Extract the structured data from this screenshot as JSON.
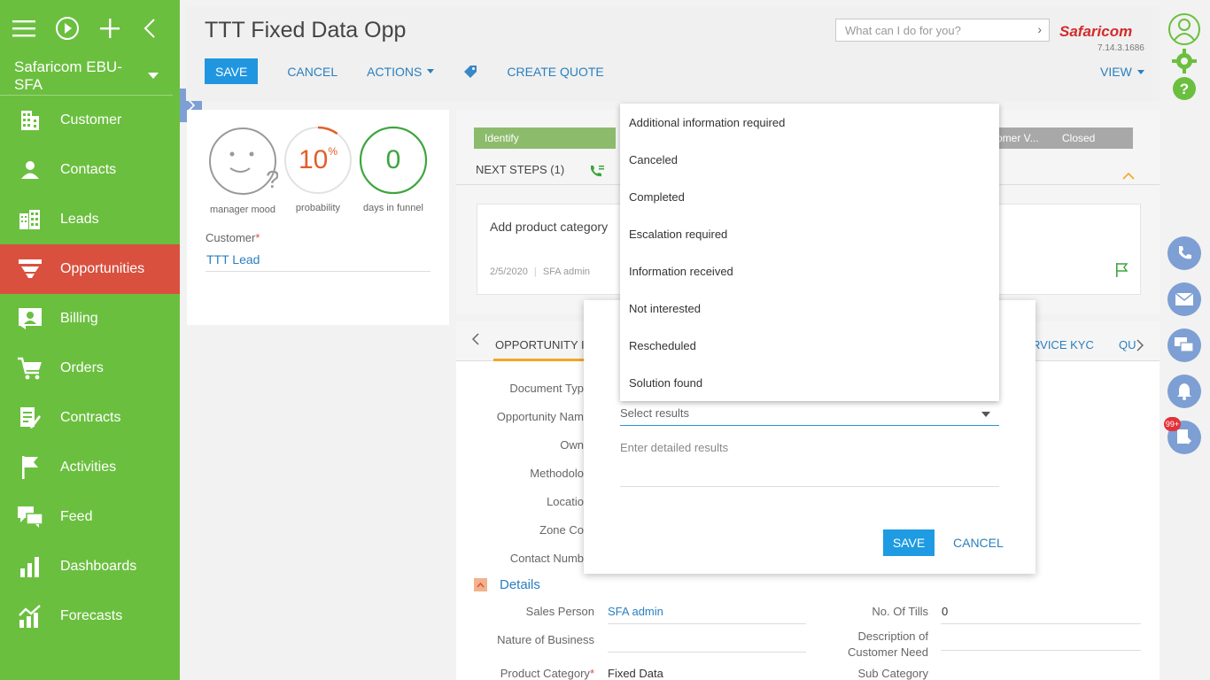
{
  "sidebar": {
    "workspace": "Safaricom EBU-SFA",
    "items": [
      {
        "label": "Customer",
        "icon": "building-icon"
      },
      {
        "label": "Contacts",
        "icon": "person-icon"
      },
      {
        "label": "Leads",
        "icon": "buildings-icon"
      },
      {
        "label": "Opportunities",
        "icon": "funnel-icon"
      },
      {
        "label": "Billing",
        "icon": "id-card-icon"
      },
      {
        "label": "Orders",
        "icon": "cart-icon"
      },
      {
        "label": "Contracts",
        "icon": "document-pen-icon"
      },
      {
        "label": "Activities",
        "icon": "flag-icon"
      },
      {
        "label": "Feed",
        "icon": "chat-icon"
      },
      {
        "label": "Dashboards",
        "icon": "bar-chart-icon"
      },
      {
        "label": "Forecasts",
        "icon": "trend-chart-icon"
      }
    ],
    "active_item": "Opportunities"
  },
  "header": {
    "title": "TTT Fixed Data Opp",
    "save_label": "SAVE",
    "cancel_label": "CANCEL",
    "actions_label": "ACTIONS",
    "create_quote_label": "CREATE QUOTE",
    "view_label": "VIEW",
    "search_placeholder": "What can I do for you?",
    "logo_text": "Safaricom",
    "version": "7.14.3.1686"
  },
  "summary": {
    "mood_label": "manager mood",
    "probability_value": "10",
    "probability_unit": "%",
    "probability_label": "probability",
    "days_value": "0",
    "days_label": "days in funnel",
    "customer_label": "Customer",
    "customer_value": "TTT Lead"
  },
  "stages": {
    "first": "Identify",
    "partial": "omer V...",
    "last": "Closed"
  },
  "next_steps": {
    "label": "NEXT STEPS (1)",
    "task_title": "Add product category",
    "task_date": "2/5/2020",
    "task_owner": "SFA admin"
  },
  "tabs": {
    "first": "OPPORTUNITY IN",
    "kyc": "RVICE KYC",
    "last": "QU"
  },
  "form": {
    "labels": [
      "Document Typ",
      "Opportunity Nam",
      "Own",
      "Methodolo",
      "Locatio",
      "Zone Co",
      "Contact Numb"
    ],
    "details_label": "Details",
    "sales_person_label": "Sales Person",
    "sales_person_value": "SFA admin",
    "nature_label": "Nature of Business",
    "product_category_label": "Product Category",
    "product_category_value": "Fixed Data",
    "tills_label": "No. Of Tills",
    "tills_value": "0",
    "desc_label_1": "Description of",
    "desc_label_2": "Customer Need",
    "sub_category_label": "Sub Category"
  },
  "modal": {
    "select_placeholder": "Select results",
    "detail_placeholder": "Enter detailed results",
    "save_label": "SAVE",
    "cancel_label": "CANCEL"
  },
  "dropdown": {
    "options": [
      "Additional information required",
      "Canceled",
      "Completed",
      "Escalation required",
      "Information received",
      "Not interested",
      "Rescheduled",
      "Solution found"
    ]
  },
  "rail": {
    "badge": "99+"
  },
  "colors": {
    "sidebar": "#6bbf3f",
    "active": "#d9503f",
    "accent": "#2196e0",
    "rail": "#7d9fd3"
  }
}
